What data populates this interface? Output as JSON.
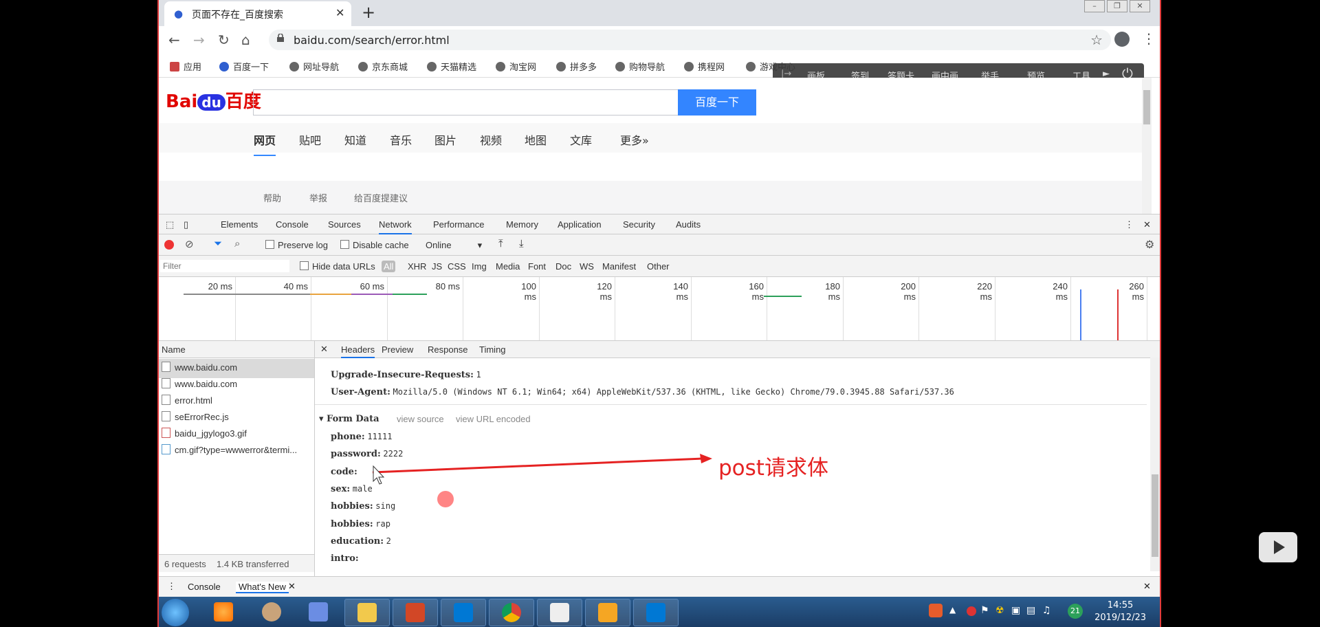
{
  "browser": {
    "tab_title": "页面不存在_百度搜索",
    "url": "baidu.com/search/error.html",
    "bookmarks": [
      "应用",
      "百度一下",
      "网址导航",
      "京东商城",
      "天猫精选",
      "淘宝网",
      "拼多多",
      "购物导航",
      "携程网",
      "游戏中心"
    ]
  },
  "floatbar": [
    "画板",
    "签到",
    "答题卡",
    "画中画",
    "举手",
    "预览",
    "工具"
  ],
  "baidu": {
    "search_button": "百度一下",
    "nav": [
      "网页",
      "贴吧",
      "知道",
      "音乐",
      "图片",
      "视频",
      "地图",
      "文库",
      "更多»"
    ],
    "footer": [
      "帮助",
      "举报",
      "给百度提建议"
    ]
  },
  "devtools": {
    "tabs": [
      "Elements",
      "Console",
      "Sources",
      "Network",
      "Performance",
      "Memory",
      "Application",
      "Security",
      "Audits"
    ],
    "preserve_log": "Preserve log",
    "disable_cache": "Disable cache",
    "throttle": "Online",
    "filter_placeholder": "Filter",
    "hide_data_urls": "Hide data URLs",
    "filter_types": [
      "All",
      "XHR",
      "JS",
      "CSS",
      "Img",
      "Media",
      "Font",
      "Doc",
      "WS",
      "Manifest",
      "Other"
    ],
    "timeline_ticks": [
      "20 ms",
      "40 ms",
      "60 ms",
      "80 ms",
      "100 ms",
      "120 ms",
      "140 ms",
      "160 ms",
      "180 ms",
      "200 ms",
      "220 ms",
      "240 ms",
      "260 ms"
    ],
    "name_header": "Name",
    "requests": [
      "www.baidu.com",
      "www.baidu.com",
      "error.html",
      "seErrorRec.js",
      "baidu_jgylogo3.gif",
      "cm.gif?type=wwwerror&termi..."
    ],
    "status_requests": "6 requests",
    "status_transferred": "1.4 KB transferred",
    "detail_tabs": [
      "Headers",
      "Preview",
      "Response",
      "Timing"
    ],
    "headers": {
      "uir_key": "Upgrade-Insecure-Requests:",
      "uir_val": "1",
      "ua_key": "User-Agent:",
      "ua_val": "Mozilla/5.0 (Windows NT 6.1; Win64; x64) AppleWebKit/537.36 (KHTML, like Gecko) Chrome/79.0.3945.88 Safari/537.36"
    },
    "form_data": {
      "title": "▾ Form Data",
      "view_source": "view source",
      "view_url_encoded": "view URL encoded",
      "fields": [
        {
          "k": "phone:",
          "v": "11111"
        },
        {
          "k": "password:",
          "v": "2222"
        },
        {
          "k": "code:",
          "v": ""
        },
        {
          "k": "sex:",
          "v": "male"
        },
        {
          "k": "hobbies:",
          "v": "sing"
        },
        {
          "k": "hobbies:",
          "v": "rap"
        },
        {
          "k": "education:",
          "v": "2"
        },
        {
          "k": "intro:",
          "v": ""
        }
      ]
    },
    "drawer_tabs": [
      "Console",
      "What's New"
    ]
  },
  "annotation": "post请求体",
  "taskbar": {
    "time": "14:55",
    "date": "2019/12/23",
    "badge": "21"
  }
}
